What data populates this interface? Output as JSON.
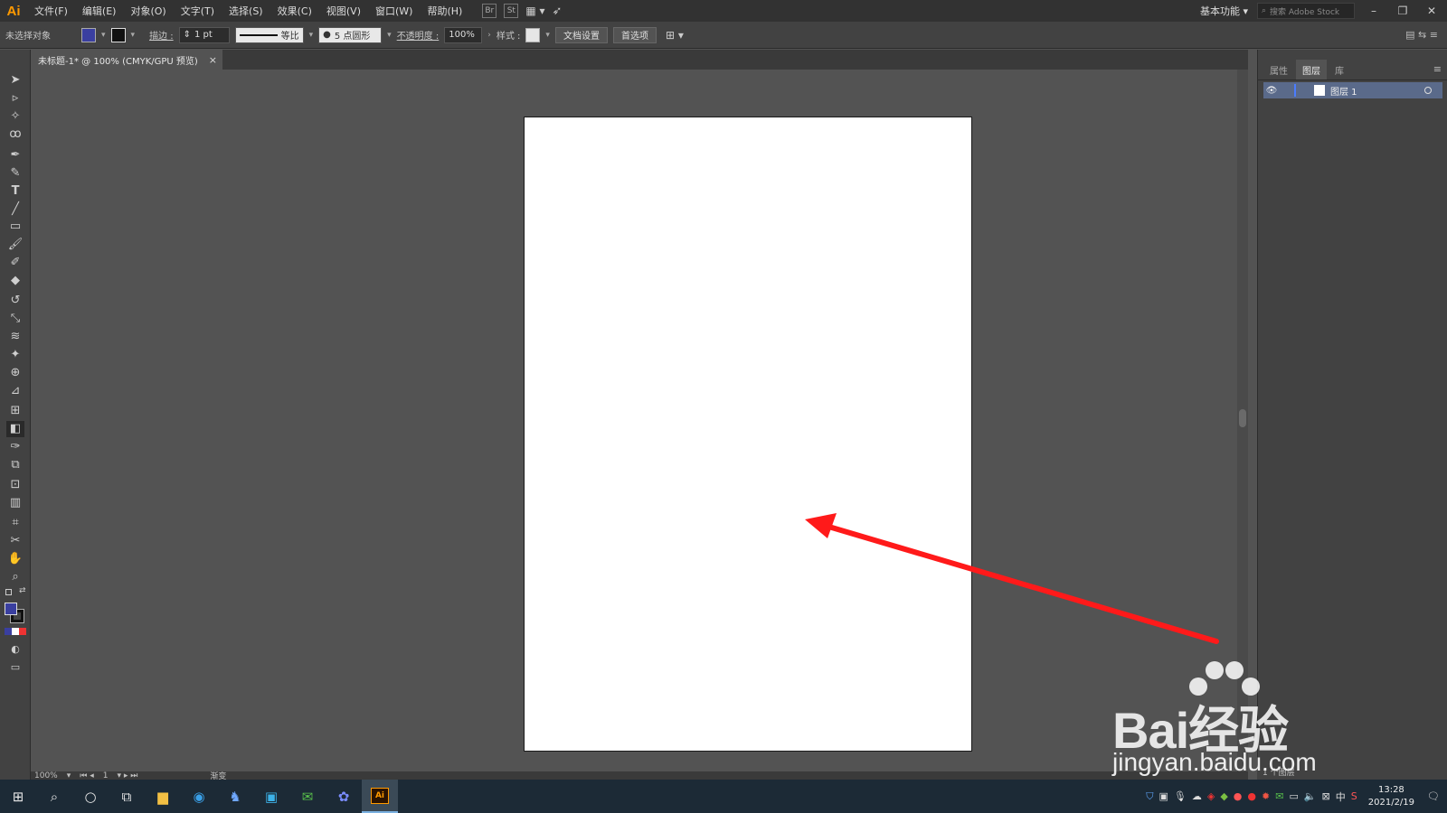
{
  "app": {
    "logo": "Ai"
  },
  "menubar": {
    "items": [
      "文件(F)",
      "编辑(E)",
      "对象(O)",
      "文字(T)",
      "选择(S)",
      "效果(C)",
      "视图(V)",
      "窗口(W)",
      "帮助(H)"
    ],
    "icons": [
      "Br",
      "St"
    ],
    "workspace": "基本功能",
    "search_placeholder": "搜索 Adobe Stock"
  },
  "controlbar": {
    "selection": "未选择对象",
    "stroke_label": "描边 :",
    "stroke_value": "1 pt",
    "profile": "等比",
    "brush": "5 点圆形",
    "opacity_label": "不透明度 :",
    "opacity_value": "100%",
    "style_label": "样式 :",
    "doc_setup": "文档设置",
    "preferences": "首选项"
  },
  "document": {
    "tab_title": "未标题-1* @ 100% (CMYK/GPU 预览)",
    "close": "×"
  },
  "panel": {
    "tabs": [
      "属性",
      "图层",
      "库"
    ],
    "active_tab": 1,
    "layer_name": "图层 1",
    "status": "1 个图层"
  },
  "statusbar": {
    "zoom": "100%",
    "page": "1",
    "tool": "渐变"
  },
  "taskbar": {
    "time": "13:28",
    "date": "2021/2/19",
    "ime": "中",
    "ai_label": "Ai"
  },
  "watermark": {
    "brand": "Bai经验",
    "url": "jingyan.baidu.com"
  },
  "colors": {
    "fill": "#3a3fa0",
    "arrow": "#ff1a1a",
    "accent": "#ff9a00"
  }
}
